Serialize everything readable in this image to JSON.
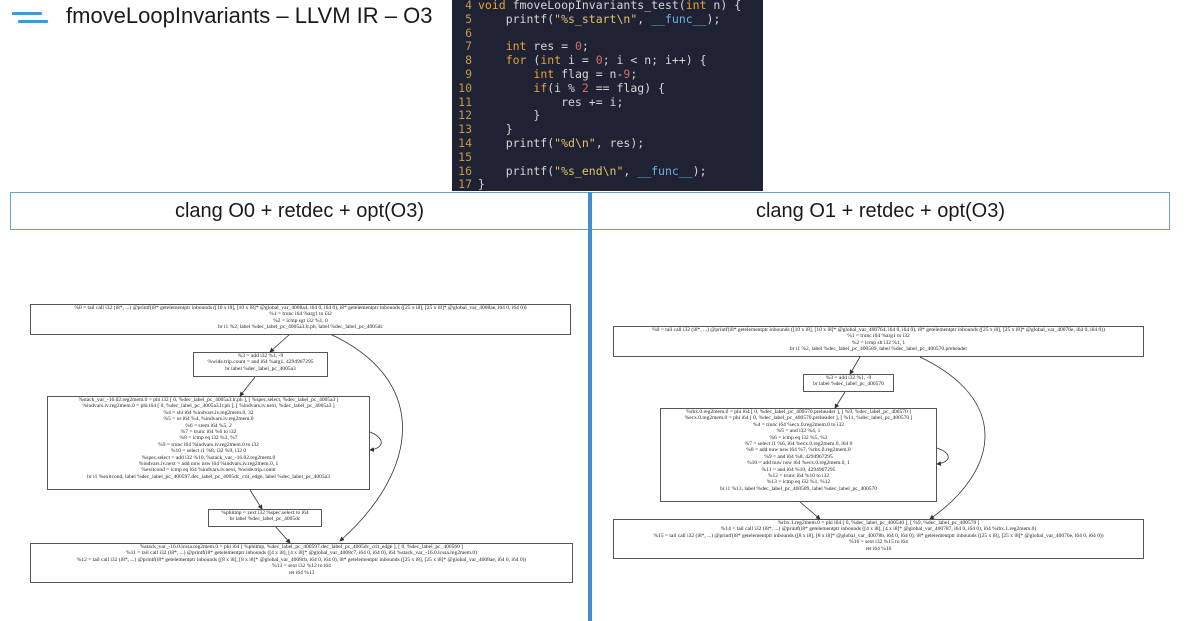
{
  "title": "fmoveLoopInvariants – LLVM IR – O3",
  "code": {
    "lines": [
      {
        "n": "4",
        "html": "<span class='kw'>void</span> fmoveLoopInvariants_test(<span class='kw'>int</span> n) {"
      },
      {
        "n": "5",
        "html": "    printf(<span class='str'>\"%s_start\\n\"</span>, <span class='fn'>__func__</span>);"
      },
      {
        "n": "6",
        "html": ""
      },
      {
        "n": "7",
        "html": "    <span class='kw'>int</span> res = <span class='num'>0</span>;"
      },
      {
        "n": "8",
        "html": "    <span class='kw'>for</span> (<span class='kw'>int</span> i = <span class='num'>0</span>; i &lt; n; i++) {"
      },
      {
        "n": "9",
        "html": "        <span class='kw'>int</span> flag = n-<span class='num'>9</span>;"
      },
      {
        "n": "10",
        "html": "        <span class='kw'>if</span>(i % <span class='num'>2</span> == flag) {"
      },
      {
        "n": "11",
        "html": "            res += i;"
      },
      {
        "n": "12",
        "html": "        }"
      },
      {
        "n": "13",
        "html": "    }"
      },
      {
        "n": "14",
        "html": "    printf(<span class='str'>\"%d\\n\"</span>, res);"
      },
      {
        "n": "15",
        "html": ""
      },
      {
        "n": "16",
        "html": "    printf(<span class='str'>\"%s_end\\n\"</span>, <span class='fn'>__func__</span>);"
      },
      {
        "n": "17",
        "html": "}"
      }
    ]
  },
  "left_panel": {
    "header": "clang O0 + retdec + opt(O3)",
    "nodes": [
      "%0 = tail call i32 (i8*, ...) @printf(i8* getelementptr inbounds ([10 x i8], [10 x i8]* @global_var_4008a4, i64 0, i64 0), i8* getelementptr inbounds ([25 x i8], [25 x i8]* @global_var_4008ae, i64 0, i64 0))\n%1 = trunc i64 %arg1 to i32\n%2 = icmp sgt i32 %1, 0\nbr i1 %2, label %dec_label_pc_4005a3.lr.ph, label %dec_label_pc_4005dc",
      "%3 = add i32 %1, -9\n%wide.trip.count = and i64 %arg1, 4294967295\nbr label %dec_label_pc_4005a3",
      "%stack_var_-16.02.reg2mem.0 = phi i32 [ 0, %dec_label_pc_4005a3.lr.ph ], [ %spec.select, %dec_label_pc_4005a3 ]\n%indvars.iv.reg2mem.0 = phi i64 [ 0, %dec_label_pc_4005a3.lr.ph ], [ %indvars.iv.next, %dec_label_pc_4005a3 ]\n%4 = shl i64 %indvars.iv.reg2mem.0, 32\n%5 = or i64 %4, %indvars.iv.reg2mem.0\n%6 = srem i64 %5, 2\n%7 = trunc i64 %6 to i32\n%8 = icmp eq i32 %3, %7\n%9 = trunc i64 %indvars.iv.reg2mem.0 to i32\n%10 = select i1 %8, i32 %9, i32 0\n%spec.select = add i32 %10, %stack_var_-16.02.reg2mem.0\n%indvars.iv.next = add nuw nsw i64 %indvars.iv.reg2mem.0, 1\n%exitcond = icmp eq i64 %indvars.iv.next, %wide.trip.count\nbr i1 %exitcond, label %dec_label_pc_400597.dec_label_pc_4005dc_crit_edge, label %dec_label_pc_4005a3",
      "%phitmp = zext i32 %spec.select to i64\nbr label %dec_label_pc_4005dc",
      "%stack_var_-16.0.lcssa.reg2mem.0 = phi i64 [ %phitmp, %dec_label_pc_400597.dec_label_pc_4005dc_crit_edge ], [ 0, %dec_label_pc_400560 ]\n%11 = tail call i32 (i8*, ...) @printf(i8* getelementptr inbounds ([4 x i8], [4 x i8]* @global_var_4008c7, i64 0, i64 0), i64 %stack_var_-16.0.lcssa.reg2mem.0)\n%12 = tail call i32 (i8*, ...) @printf(i8* getelementptr inbounds ([8 x i8], [8 x i8]* @global_var_4008cb, i64 0, i64 0), i8* getelementptr inbounds ([25 x i8], [25 x i8]* @global_var_4008ae, i64 0, i64 0))\n%13 = sext i32 %12 to i64\nret i64 %13"
    ]
  },
  "right_panel": {
    "header": "clang O1 + retdec + opt(O3)",
    "nodes": [
      "%0 = tail call i32 (i8*, ...) @printf(i8* getelementptr inbounds ([10 x i8], [10 x i8]* @global_var_400764, i64 0, i64 0), i8* getelementptr inbounds ([25 x i8], [25 x i8]* @global_var_40076e, i64 0, i64 0))\n%1 = trunc i64 %arg1 to i32\n%2 = icmp slt i32 %1, 1\nbr i1 %2, label %dec_label_pc_400589, label %dec_label_pc_400570.preheader",
      "%3 = add i32 %1, -9\nbr label %dec_label_pc_400570",
      "%rbx.0.reg2mem.0 = phi i64 [ 0, %dec_label_pc_400570.preheader ], [ %9, %dec_label_pc_400570 ]\n%ecx.0.reg2mem.0 = phi i64 [ 0, %dec_label_pc_400570.preheader ], [ %11, %dec_label_pc_400570 ]\n%4 = trunc i64 %ecx.0.reg2mem.0 to i32\n%5 = and i32 %4, 1\n%6 = icmp eq i32 %5, %3\n%7 = select i1 %6, i64 %ecx.0.reg2mem.0, i64 0\n%8 = add nuw nsw i64 %7, %rbx.0.reg2mem.0\n%9 = and i64 %8, 4294967295\n%10 = add nuw nsw i64 %ecx.0.reg2mem.0, 1\n%11 = and i64 %10, 4294967295\n%12 = trunc i64 %10 to i32\n%13 = icmp eq i32 %1, %12\nbr i1 %13, label %dec_label_pc_400589, label %dec_label_pc_400570",
      "%rbx.1.reg2mem.0 = phi i64 [ 0, %dec_label_pc_400540 ], [ %9, %dec_label_pc_400570 ]\n%14 = tail call i32 (i8*, ...) @printf(i8* getelementptr inbounds ([4 x i8], [4 x i8]* @global_var_400787, i64 0, i64 0), i64 %rbx.1.reg2mem.0)\n%15 = tail call i32 (i8*, ...) @printf(i8* getelementptr inbounds ([8 x i8], [8 x i8]* @global_var_40078b, i64 0, i64 0), i8* getelementptr inbounds ([25 x i8], [25 x i8]* @global_var_40076e, i64 0, i64 0))\n%16 = sext i32 %15 to i64\nret i64 %16"
    ]
  },
  "colors": {
    "accent": "#3f8fd0",
    "code_bg": "#1e2233",
    "keyword": "#e8a23c",
    "string": "#e2c36b",
    "number": "#d86c6c",
    "line_number": "#c49a4a"
  }
}
